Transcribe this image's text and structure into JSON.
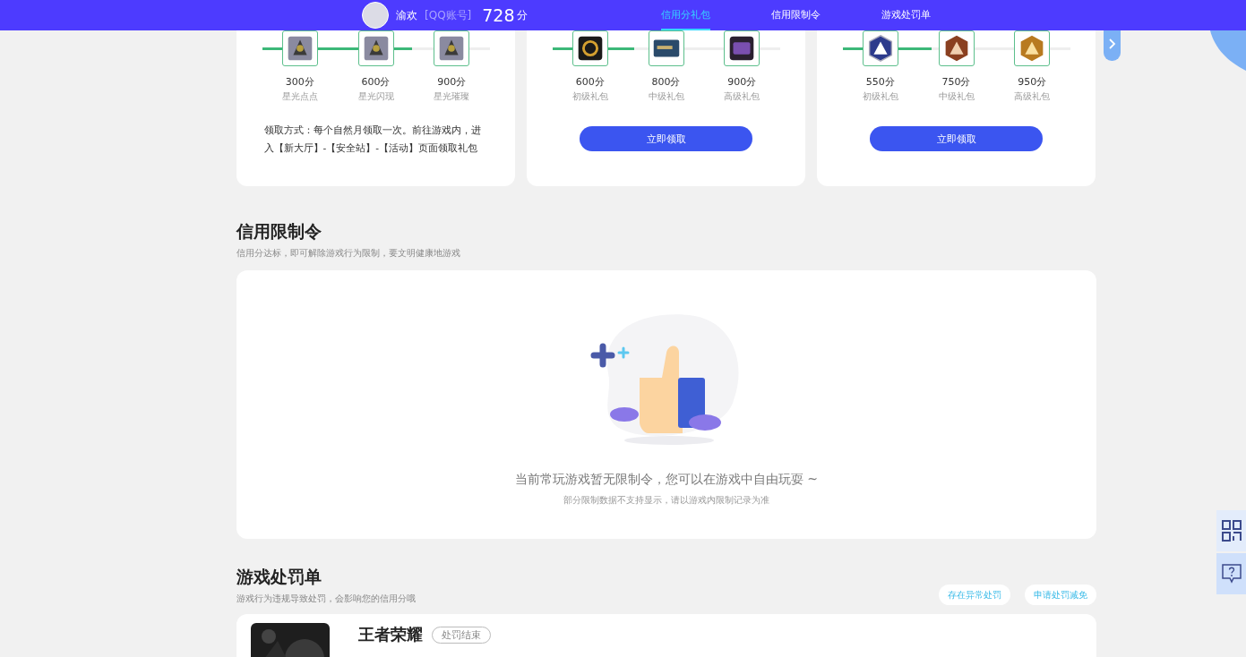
{
  "header": {
    "user_name": "渝欢",
    "account_type": "[QQ账号]",
    "score": "728",
    "score_unit": "分"
  },
  "tabs": [
    {
      "label": "信用分礼包",
      "selected": true
    },
    {
      "label": "信用限制令",
      "selected": false
    },
    {
      "label": "游戏处罚单",
      "selected": false
    }
  ],
  "gift_cards": [
    {
      "level": 0.66,
      "rewards": [
        {
          "score": "300分",
          "name": "星光点点",
          "kind": "armor"
        },
        {
          "score": "600分",
          "name": "星光闪现",
          "kind": "armor"
        },
        {
          "score": "900分",
          "name": "星光璀璨",
          "kind": "armor"
        }
      ],
      "note": "领取方式：每个自然月领取一次。前往游戏内，进入【新大厅】-【安全站】-【活动】页面领取礼包"
    },
    {
      "level": 0.36,
      "rewards": [
        {
          "score": "600分",
          "name": "初级礼包",
          "kind": "emblem"
        },
        {
          "score": "800分",
          "name": "中级礼包",
          "kind": "card"
        },
        {
          "score": "900分",
          "name": "高级礼包",
          "kind": "chest"
        }
      ],
      "button": "立即领取"
    },
    {
      "level": 0.39,
      "rewards": [
        {
          "score": "550分",
          "name": "初级礼包",
          "kind": "badge_blue"
        },
        {
          "score": "750分",
          "name": "中级礼包",
          "kind": "badge_bronze"
        },
        {
          "score": "950分",
          "name": "高级礼包",
          "kind": "badge_gold"
        }
      ],
      "button": "立即领取"
    }
  ],
  "restriction": {
    "title": "信用限制令",
    "subtitle": "信用分达标，即可解除游戏行为限制，要文明健康地游戏",
    "empty_message": "当前常玩游戏暂无限制令，您可以在游戏中自由玩耍 ~",
    "empty_note": "部分限制数据不支持显示，请以游戏内限制记录为准"
  },
  "penalty": {
    "title": "游戏处罚单",
    "subtitle": "游戏行为违规导致处罚，会影响您的信用分哦",
    "actions": [
      "存在异常处罚",
      "申请处罚减免"
    ],
    "records": [
      {
        "game": "王者荣耀",
        "status": "处罚结束"
      }
    ]
  }
}
